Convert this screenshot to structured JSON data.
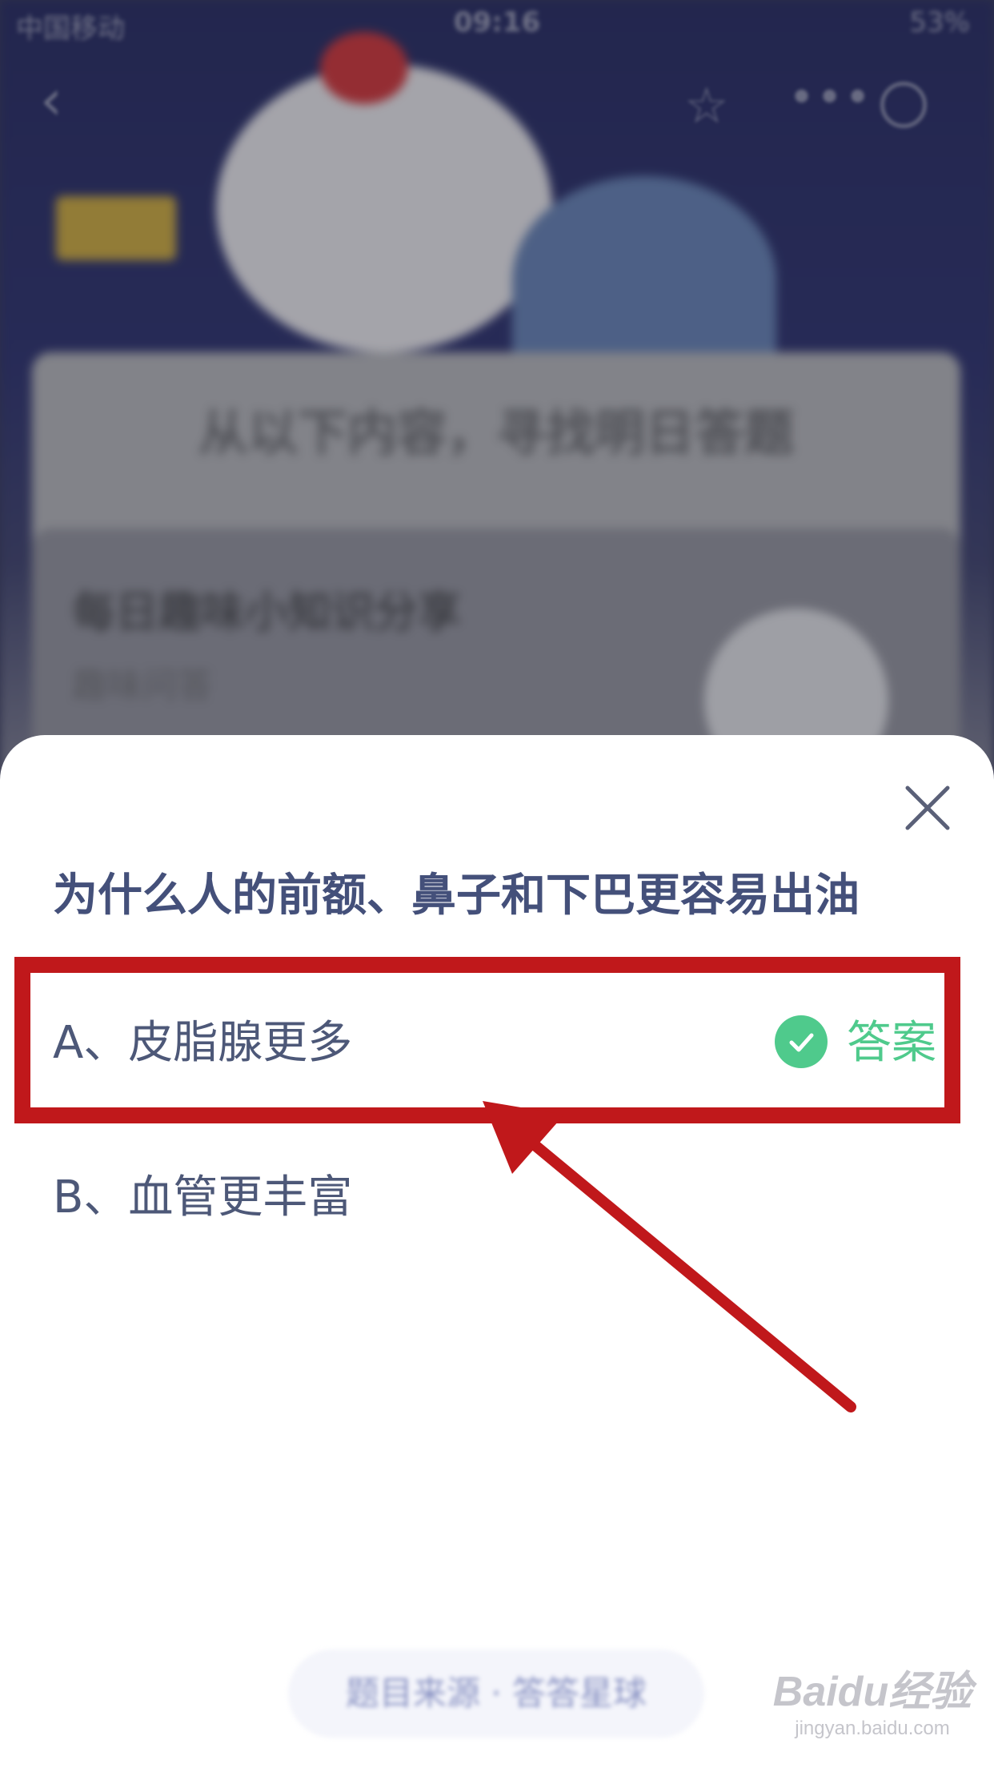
{
  "status_bar": {
    "carrier": "中国移动",
    "time": "09:16",
    "battery": "53%"
  },
  "background": {
    "headline": "从以下内容，寻找明日答题",
    "card_title": "每日趣味小知识分享",
    "card_subtitle": "趣味问答"
  },
  "sheet": {
    "question": "为什么人的前额、鼻子和下巴更容易出油",
    "options": [
      {
        "label": "A、皮脂腺更多",
        "is_answer": true,
        "answer_tag": "答案"
      },
      {
        "label": "B、血管更丰富",
        "is_answer": false
      }
    ],
    "footer_button": "题目来源 · 答答星球"
  },
  "watermark": {
    "logo": "Baidu经验",
    "url": "jingyan.baidu.com"
  },
  "colors": {
    "question_text": "#44507a",
    "option_text": "#4d5878",
    "answer_green": "#4fca8c",
    "annotation_red": "#c0181b"
  },
  "icons": [
    "back-chevron-icon",
    "star-icon",
    "more-dots-icon",
    "target-icon",
    "close-icon",
    "check-circle-icon",
    "annotation-arrow-icon"
  ]
}
